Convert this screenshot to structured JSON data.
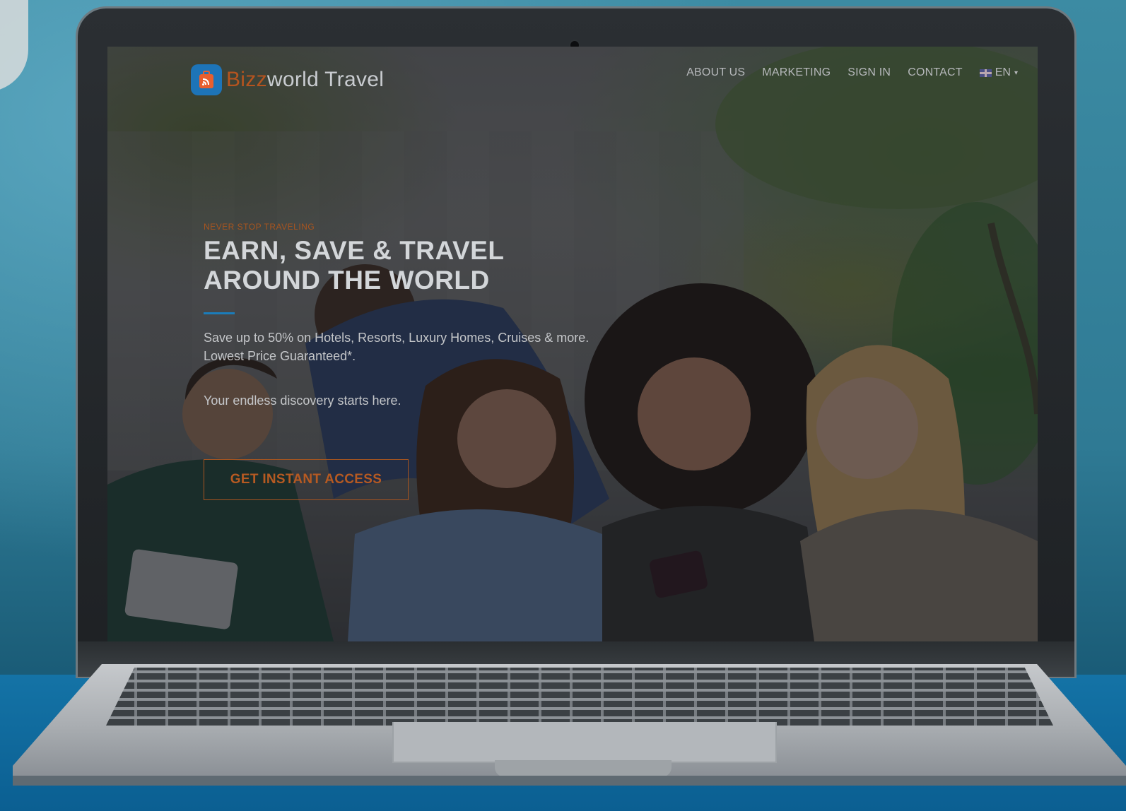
{
  "site": {
    "brand": {
      "accent": "Bizz",
      "name": "world Travel"
    },
    "nav": {
      "items": [
        "ABOUT US",
        "MARKETING",
        "SIGN IN",
        "CONTACT"
      ],
      "language": "EN",
      "language_icon": "uk-flag-icon"
    },
    "hero": {
      "kicker": "NEVER STOP TRAVELING",
      "headline_line1": "EARN, SAVE & TRAVEL",
      "headline_line2": "AROUND THE WORLD",
      "desc_line1": "Save up to 50% on Hotels, Resorts, Luxury Homes, Cruises & more.",
      "desc_line2": "Lowest Price Guaranteed*.",
      "tagline": "Your endless discovery starts here.",
      "cta": "GET INSTANT ACCESS"
    },
    "colors": {
      "accent_orange": "#b65a22",
      "accent_blue": "#1b7cb9"
    }
  }
}
